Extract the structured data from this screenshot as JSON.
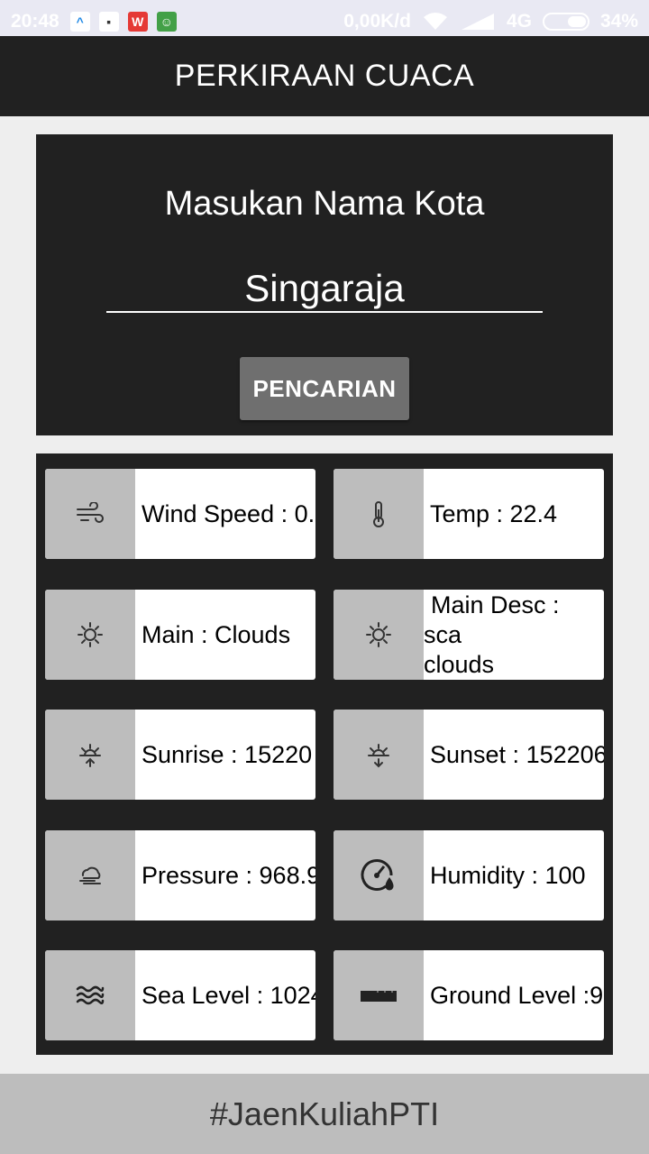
{
  "status_bar": {
    "time": "20:48",
    "net_speed": "0,00K/d",
    "network": "4G",
    "battery": "34%",
    "notification_icons": [
      "app-a-icon",
      "chat-icon",
      "wps-icon",
      "android-icon"
    ]
  },
  "app_bar": {
    "title": "PERKIRAAN CUACA"
  },
  "search": {
    "title": "Masukan Nama Kota",
    "city_value": "Singaraja",
    "button_label": "PENCARIAN"
  },
  "cards": [
    {
      "icon": "wind-icon",
      "label": "Wind Speed : 0."
    },
    {
      "icon": "thermometer-icon",
      "label": "Temp : 22.4"
    },
    {
      "icon": "sun-icon",
      "label": "Main : Clouds"
    },
    {
      "icon": "sun-icon",
      "label": "Main Desc : scattered clouds",
      "line1": "Main Desc : sca",
      "line2": "clouds"
    },
    {
      "icon": "sunrise-icon",
      "label": "Sunrise : 15220"
    },
    {
      "icon": "sunset-icon",
      "label": "Sunset : 152206"
    },
    {
      "icon": "pressure-icon",
      "label": "Pressure : 968.9"
    },
    {
      "icon": "humidity-gauge-icon",
      "label": "Humidity : 100"
    },
    {
      "icon": "sea-waves-icon",
      "label": "Sea Level : 1024"
    },
    {
      "icon": "ground-icon",
      "label": "Ground Level :9"
    }
  ],
  "footer": {
    "text": "#JaenKuliahPTI"
  },
  "colors": {
    "dark": "#212121",
    "icon_box": "#bdbdbd",
    "button": "#6f6f6f",
    "background": "#eeeeee"
  }
}
